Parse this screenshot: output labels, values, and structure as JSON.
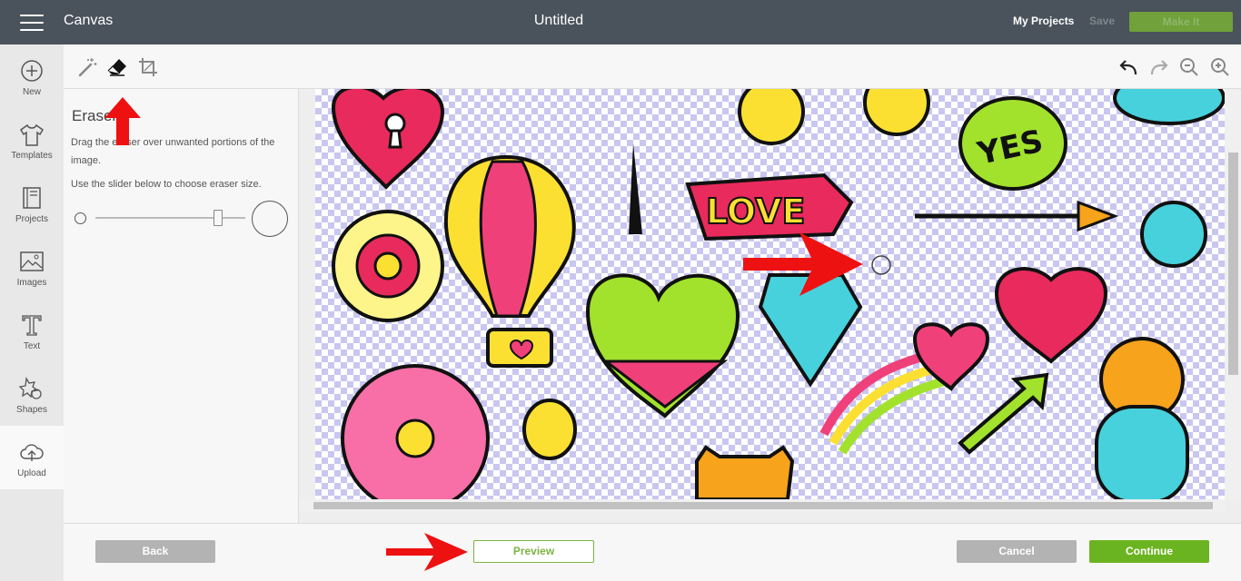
{
  "header": {
    "app_title": "Canvas",
    "doc_title": "Untitled",
    "my_projects": "My Projects",
    "save": "Save",
    "make_it": "Make It"
  },
  "sidebar": {
    "items": [
      {
        "label": "New",
        "icon": "plus-circle-icon"
      },
      {
        "label": "Templates",
        "icon": "shirt-icon"
      },
      {
        "label": "Projects",
        "icon": "projects-icon"
      },
      {
        "label": "Images",
        "icon": "image-icon"
      },
      {
        "label": "Text",
        "icon": "text-icon"
      },
      {
        "label": "Shapes",
        "icon": "shapes-icon"
      },
      {
        "label": "Upload",
        "icon": "upload-cloud-icon"
      }
    ]
  },
  "panel": {
    "title": "Eraser",
    "instruction_1": "Drag the eraser over unwanted portions of the image.",
    "instruction_2": "Use the slider below to choose eraser size.",
    "slider_value": 0.82
  },
  "canvas": {
    "text_love": "LOVE",
    "text_yes": "YES"
  },
  "footer": {
    "back": "Back",
    "preview": "Preview",
    "cancel": "Cancel",
    "continue": "Continue"
  },
  "colors": {
    "header_bg": "#4a525b",
    "accent_green": "#6bb421",
    "annotation_red": "#ee1111"
  }
}
